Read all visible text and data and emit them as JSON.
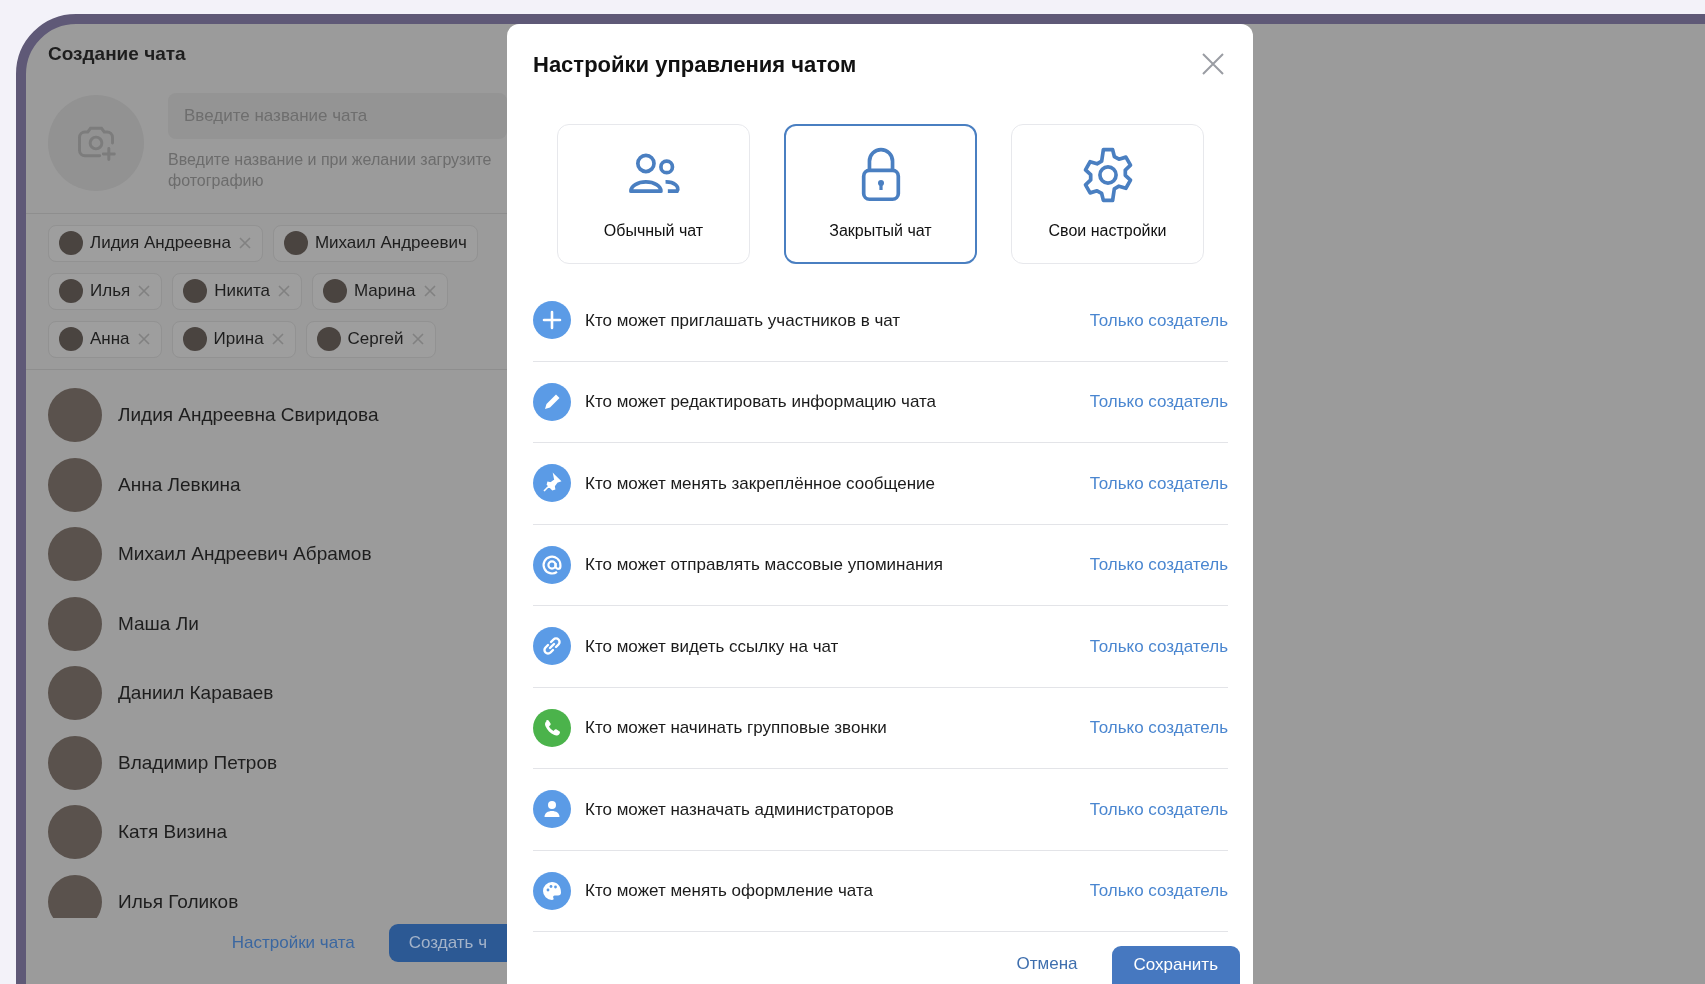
{
  "create_chat": {
    "title": "Создание чата",
    "name_field": {
      "placeholder": "Введите название чата"
    },
    "hint": "Введите название и при желании загрузите фотографию",
    "chips": [
      {
        "name": "Лидия Андреевна"
      },
      {
        "name": "Михаил Андреевич"
      },
      {
        "name": "Илья"
      },
      {
        "name": "Никита"
      },
      {
        "name": "Марина"
      },
      {
        "name": "Анна"
      },
      {
        "name": "Ирина"
      },
      {
        "name": "Сергей"
      }
    ],
    "contacts": [
      {
        "name": "Лидия Андреевна Свиридова"
      },
      {
        "name": "Анна Левкина"
      },
      {
        "name": "Михаил Андреевич Абрамов"
      },
      {
        "name": "Маша Ли"
      },
      {
        "name": "Даниил Караваев"
      },
      {
        "name": "Владимир Петров"
      },
      {
        "name": "Катя Визина"
      },
      {
        "name": "Илья Голиков"
      }
    ],
    "settings_link": "Настройки чата",
    "create_button": "Создать ч"
  },
  "modal": {
    "title": "Настройки управления чатом",
    "chat_types": [
      {
        "kind": "people",
        "label": "Обычный чат",
        "selected": false
      },
      {
        "kind": "lock",
        "label": "Закрытый чат",
        "selected": true
      },
      {
        "kind": "gear",
        "label": "Свои настройки",
        "selected": false
      }
    ],
    "permissions": [
      {
        "kind": "plus",
        "label": "Кто может приглашать участников в чат",
        "value": "Только создатель"
      },
      {
        "kind": "pencil",
        "label": "Кто может редактировать информацию чата",
        "value": "Только создатель"
      },
      {
        "kind": "pin",
        "label": "Кто может менять закреплённое сообщение",
        "value": "Только создатель"
      },
      {
        "kind": "at",
        "label": "Кто может отправлять массовые упоминания",
        "value": "Только создатель"
      },
      {
        "kind": "link",
        "label": "Кто может видеть ссылку на чат",
        "value": "Только создатель"
      },
      {
        "kind": "phone",
        "label": "Кто может начинать групповые звонки",
        "value": "Только создатель"
      },
      {
        "kind": "person",
        "label": "Кто может назначать администраторов",
        "value": "Только создатель"
      },
      {
        "kind": "palette",
        "label": "Кто может менять оформление чата",
        "value": "Только создатель"
      }
    ],
    "cancel_button": "Отмена",
    "save_button": "Сохранить"
  }
}
